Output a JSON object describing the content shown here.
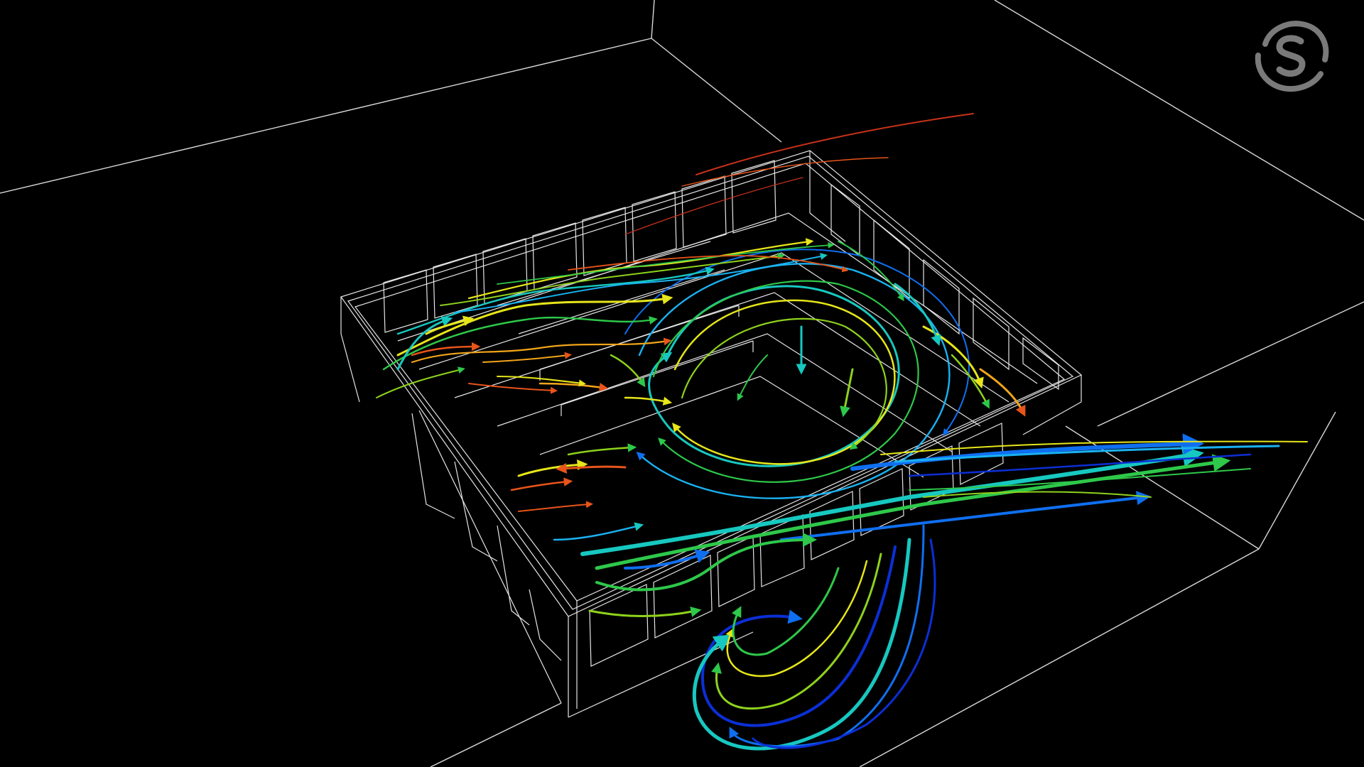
{
  "scene": {
    "background": "#000000",
    "wireframe_color": "#ffffff",
    "logo_color": "#7a7a7a",
    "icons": {
      "logo": "swirl-s-logo-icon"
    },
    "colormap": [
      "#0b2fd6",
      "#0f6ff0",
      "#1ab2f2",
      "#17c8c0",
      "#2ec84a",
      "#8ed21c",
      "#e6e61a",
      "#f2a51a",
      "#e8541a",
      "#c9321a"
    ]
  }
}
